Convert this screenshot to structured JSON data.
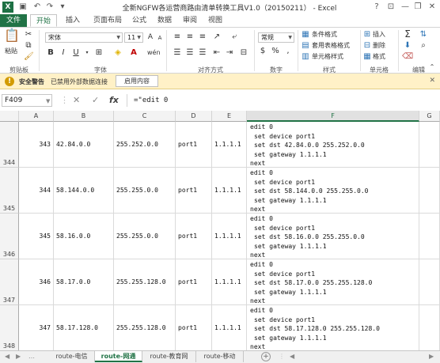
{
  "window": {
    "title": "全新NGFW各运营商路由清单转换工具V1.0（20150211） - Excel",
    "help": "?",
    "minimize": "—",
    "restore": "❐",
    "close": "✕"
  },
  "quick_access": {
    "excel_icon": "X",
    "save": "💾",
    "undo": "↶",
    "redo": "↷"
  },
  "ribbon_tabs": [
    {
      "label": "文件"
    },
    {
      "label": "开始"
    },
    {
      "label": "插入"
    },
    {
      "label": "页面布局"
    },
    {
      "label": "公式"
    },
    {
      "label": "数据"
    },
    {
      "label": "审阅"
    },
    {
      "label": "视图"
    }
  ],
  "ribbon": {
    "clipboard": {
      "paste": "粘贴",
      "group": "剪贴板"
    },
    "font": {
      "name": "宋体",
      "size": "11",
      "bold": "B",
      "italic": "I",
      "underline": "U",
      "group": "字体",
      "grow": "A",
      "shrink": "A",
      "wen": "wén"
    },
    "alignment": {
      "group": "对齐方式"
    },
    "number": {
      "format": "常规",
      "group": "数字",
      "percent": "%",
      "comma": ",",
      "currency": "$"
    },
    "styles": {
      "conditional": "条件格式",
      "table": "套用表格格式",
      "cell": "单元格样式",
      "group": "样式"
    },
    "cells": {
      "insert": "插入",
      "delete": "删除",
      "format": "格式",
      "group": "单元格"
    },
    "editing": {
      "sum": "Σ",
      "group": "编辑"
    }
  },
  "security_bar": {
    "title": "安全警告",
    "message": "已禁用外部数据连接",
    "button": "启用内容",
    "icon": "!"
  },
  "formula_bar": {
    "name_box": "F409",
    "cancel_icon": "✕",
    "enter_icon": "✓",
    "fx": "fx",
    "formula": "=\"edit 0"
  },
  "grid": {
    "columns": [
      "A",
      "B",
      "C",
      "D",
      "E",
      "F",
      "G"
    ],
    "selected_column": "F",
    "rows": [
      {
        "row": "344",
        "a": "343",
        "b": "42.84.0.0",
        "c": "255.252.0.0",
        "d": "port1",
        "e": "1.1.1.1",
        "f": [
          "edit 0",
          "set device port1",
          "set dst 42.84.0.0  255.252.0.0",
          "set gateway 1.1.1.1",
          "next"
        ]
      },
      {
        "row": "345",
        "a": "344",
        "b": "58.144.0.0",
        "c": "255.255.0.0",
        "d": "port1",
        "e": "1.1.1.1",
        "f": [
          "edit 0",
          "set device port1",
          "set dst 58.144.0.0  255.255.0.0",
          "set gateway 1.1.1.1",
          "next"
        ]
      },
      {
        "row": "346",
        "a": "345",
        "b": "58.16.0.0",
        "c": "255.255.0.0",
        "d": "port1",
        "e": "1.1.1.1",
        "f": [
          "edit 0",
          "set device port1",
          "set dst 58.16.0.0  255.255.0.0",
          "set gateway 1.1.1.1",
          "next"
        ]
      },
      {
        "row": "347",
        "a": "346",
        "b": "58.17.0.0",
        "c": "255.255.128.0",
        "d": "port1",
        "e": "1.1.1.1",
        "f": [
          "edit 0",
          "set device port1",
          "set dst 58.17.0.0  255.255.128.0",
          "set gateway 1.1.1.1",
          "next"
        ]
      },
      {
        "row": "348",
        "a": "347",
        "b": "58.17.128.0",
        "c": "255.255.128.0",
        "d": "port1",
        "e": "1.1.1.1",
        "f": [
          "edit 0",
          "set device port1",
          "set dst 58.17.128.0  255.255.128.0",
          "set gateway 1.1.1.1",
          "next"
        ]
      }
    ]
  },
  "sheet_tabs": [
    {
      "label": "route-电信"
    },
    {
      "label": "route-网通"
    },
    {
      "label": "route-教育网"
    },
    {
      "label": "route-移动"
    }
  ],
  "active_sheet": "route-网通",
  "colors": {
    "accent": "#217346",
    "security_bg": "#fff1c7"
  }
}
